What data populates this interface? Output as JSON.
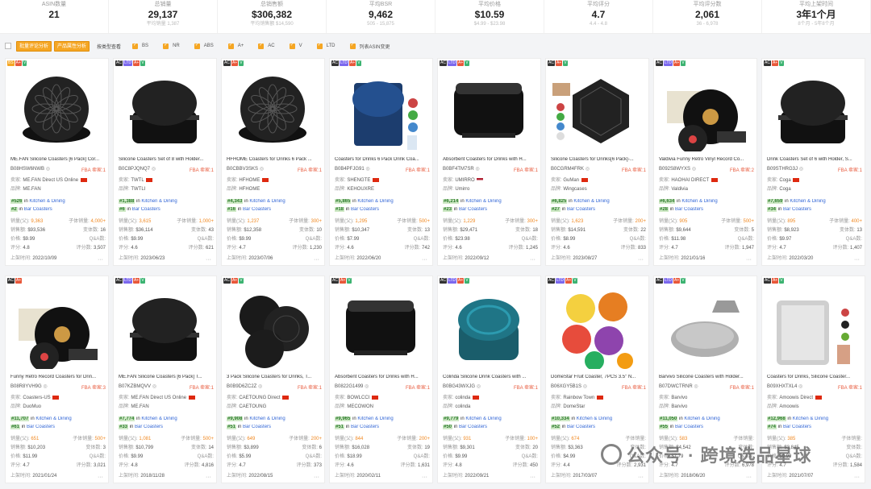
{
  "stats": [
    {
      "label": "ASIN数量",
      "value": "21",
      "sub": ""
    },
    {
      "label": "总销量",
      "value": "29,137",
      "sub": "平均销量 1,387"
    },
    {
      "label": "总销售额",
      "value": "$306,382",
      "sub": "平均销售额 $14,590"
    },
    {
      "label": "平均BSR",
      "value": "9,462",
      "sub": "505 - 15,875"
    },
    {
      "label": "平均价格",
      "value": "$10.59",
      "sub": "$4.99 - $23.98"
    },
    {
      "label": "平均评分",
      "value": "4.7",
      "sub": "4.4 - 4.8"
    },
    {
      "label": "平均评分数",
      "value": "2,061",
      "sub": "36 - 6,978"
    },
    {
      "label": "平均上架时间",
      "value": "3年1个月",
      "sub": "8个月 - 5年8个月"
    }
  ],
  "toolbar": {
    "btn1": "批量评论分析",
    "btn2": "产品属性分析",
    "label": "按类型查看",
    "checks": [
      "BS",
      "NR",
      "ABS",
      "A+",
      "AC",
      "V",
      "LTD",
      "列表ASIN变更"
    ]
  },
  "labels": {
    "seller": "卖家:",
    "brand": "品牌:",
    "in": "in",
    "sales": "销量(父):",
    "child_sales": "子体销量:",
    "revenue": "销售额:",
    "variants": "变体数:",
    "price": "价格:",
    "qa": "Q&A数:",
    "rating": "评分:",
    "reviews": "评分数:",
    "listed": "上架时间:",
    "fba": "FBA",
    "sellers_n": "卖家:",
    "more": "···"
  },
  "products": [
    {
      "tags": [
        "best",
        "aplus",
        "v"
      ],
      "title": "ME.FAN Silicone Coasters [6 Pack] Cor...",
      "asin": "B08HSW6NWB",
      "sellers": "1",
      "seller": "ME.FAN Direct US Online",
      "brand": "ME.FAN",
      "r1": "#526",
      "c1": "Kitchen & Dining",
      "r2": "#2",
      "c2": "Bar Coasters",
      "sales": "9,363",
      "child": "4,000+",
      "revenue": "$93,536",
      "variants": "16",
      "price": "$9.99",
      "qa": "",
      "rating": "4.8",
      "reviews": "3,507",
      "date": "2022/10/09",
      "flag": "cn",
      "shape": "flower"
    },
    {
      "tags": [
        "ac",
        "ltd",
        "aplus",
        "v"
      ],
      "title": "Silicone Coasters Set of 8 with Holder...",
      "asin": "B0C8PJQNQ7",
      "sellers": "1",
      "seller": "TWTL",
      "brand": "TWTLI",
      "r1": "#1,388",
      "c1": "Kitchen & Dining",
      "r2": "#6",
      "c2": "Bar Coasters",
      "sales": "3,615",
      "child": "1,000+",
      "revenue": "$36,114",
      "variants": "43",
      "price": "$9.99",
      "qa": "",
      "rating": "4.6",
      "reviews": "621",
      "date": "2023/06/23",
      "flag": "cn",
      "shape": "stack"
    },
    {
      "tags": [
        "ac",
        "aplus",
        "v"
      ],
      "title": "HFHOME Coasters for Drinks 6 Pack ...",
      "asin": "B0CBBV3SKS",
      "sellers": "1",
      "seller": "HFHOME",
      "brand": "HFHOME",
      "r1": "#4,343",
      "c1": "Kitchen & Dining",
      "r2": "#16",
      "c2": "Bar Coasters",
      "sales": "1,237",
      "child": "300+",
      "revenue": "$12,358",
      "variants": "10",
      "price": "$9.99",
      "qa": "",
      "rating": "4.7",
      "reviews": "1,230",
      "date": "2023/07/06",
      "flag": "cn",
      "shape": "flower"
    },
    {
      "tags": [
        "ac",
        "ltd",
        "aplus",
        "v"
      ],
      "title": "Coasters for Drinks 6 Pack Drink Coa...",
      "asin": "B0B4PFJG91",
      "sellers": "1",
      "seller": "SHENGTE",
      "brand": "KEHOUXRE",
      "r1": "#5,865",
      "c1": "Kitchen & Dining",
      "r2": "#18",
      "c2": "Bar Coasters",
      "sales": "1,295",
      "child": "500+",
      "revenue": "$10,347",
      "variants": "13",
      "price": "$7.99",
      "qa": "",
      "rating": "4.6",
      "reviews": "742",
      "date": "2022/06/20",
      "flag": "cn",
      "shape": "blue"
    },
    {
      "tags": [
        "ac",
        "ltd",
        "aplus",
        "v"
      ],
      "title": "Absorbent Coasters for Drinks with H...",
      "asin": "B0BF4TM7SR",
      "sellers": "1",
      "seller": "UMIRRO",
      "brand": "Umirro",
      "r1": "#6,214",
      "c1": "Kitchen & Dining",
      "r2": "#23",
      "c2": "Bar Coasters",
      "sales": "1,229",
      "child": "300+",
      "revenue": "$29,471",
      "variants": "18",
      "price": "$23.98",
      "qa": "",
      "rating": "4.6",
      "reviews": "1,245",
      "date": "2022/09/12",
      "flag": "us",
      "shape": "square"
    },
    {
      "tags": [
        "ac",
        "aplus",
        "v"
      ],
      "title": "Silicone Coasters for Drinks[6 Pack]-...",
      "asin": "B0CGRM4FRK",
      "sellers": "1",
      "seller": "GuMan",
      "brand": "Wingcases",
      "r1": "#6,825",
      "c1": "Kitchen & Dining",
      "r2": "#27",
      "c2": "Bar Coasters",
      "sales": "1,623",
      "child": "200+",
      "revenue": "$14,591",
      "variants": "22",
      "price": "$8.99",
      "qa": "",
      "rating": "4.6",
      "reviews": "833",
      "date": "2023/08/27",
      "flag": "cn",
      "shape": "hex"
    },
    {
      "tags": [
        "ac",
        "ltd",
        "aplus",
        "v"
      ],
      "title": "Valdivia Funny Retro Vinyl Record Co...",
      "asin": "B092S8WYXS",
      "sellers": "2",
      "seller": "HAOHAI DIRECT",
      "brand": "Valdivia",
      "r1": "#6,634",
      "c1": "Kitchen & Dining",
      "r2": "#28",
      "c2": "Bar Coasters",
      "sales": "905",
      "child": "500+",
      "revenue": "$9,644",
      "variants": "5",
      "price": "$11.98",
      "qa": "",
      "rating": "4.7",
      "reviews": "1,947",
      "date": "2021/01/16",
      "flag": "cn",
      "shape": "vinyl"
    },
    {
      "tags": [
        "ac",
        "aplus",
        "v"
      ],
      "title": "Drink Coasters Set of 6 with Holder, S...",
      "asin": "B09STHRG3J",
      "sellers": "1",
      "seller": "Coga",
      "brand": "Coga",
      "r1": "#7,659",
      "c1": "Kitchen & Dining",
      "r2": "#34",
      "c2": "Bar Coasters",
      "sales": "895",
      "child": "400+",
      "revenue": "$8,923",
      "variants": "13",
      "price": "$9.97",
      "qa": "",
      "rating": "4.7",
      "reviews": "1,407",
      "date": "2022/03/20",
      "flag": "cn",
      "shape": "stack"
    },
    {
      "tags": [
        "ac",
        "aplus"
      ],
      "title": "Funny Retro Record Coasters for Drin...",
      "asin": "B08R8YVH9G",
      "sellers": "3",
      "seller": "Coasters-US",
      "brand": "DuoMuo",
      "r1": "#11,707",
      "c1": "Kitchen & Dining",
      "r2": "#61",
      "c2": "Bar Coasters",
      "sales": "651",
      "child": "500+",
      "revenue": "$10,203",
      "variants": "3",
      "price": "$11.99",
      "qa": "",
      "rating": "4.7",
      "reviews": "3,021",
      "date": "2021/01/24",
      "flag": "cn",
      "shape": "vinyl"
    },
    {
      "tags": [
        "ac",
        "ltd",
        "aplus",
        "v"
      ],
      "title": "ME.FAN Silicone Coasters [6 Pack] T...",
      "asin": "B07KZBMQVV",
      "sellers": "1",
      "seller": "ME.FAN Direct US Online",
      "brand": "ME.FAN",
      "r1": "#7,774",
      "c1": "Kitchen & Dining",
      "r2": "#33",
      "c2": "Bar Coasters",
      "sales": "1,081",
      "child": "500+",
      "revenue": "$10,799",
      "variants": "14",
      "price": "$9.99",
      "qa": "",
      "rating": "4.8",
      "reviews": "4,816",
      "date": "2018/11/28",
      "flag": "cn",
      "shape": "stack"
    },
    {
      "tags": [
        "ac",
        "aplus",
        "v"
      ],
      "title": "3 Pack Silicone Coasters for Drinks, T...",
      "asin": "B0B9D6ZC2Z",
      "sellers": "1",
      "seller": "CAETOUNG Direct",
      "brand": "CAETOUNG",
      "r1": "#9,908",
      "c1": "Kitchen & Dining",
      "r2": "#51",
      "c2": "Bar Coasters",
      "sales": "649",
      "child": "200+",
      "revenue": "$3,899",
      "variants": "6",
      "price": "$5.99",
      "qa": "",
      "rating": "4.7",
      "reviews": "373",
      "date": "2022/08/15",
      "flag": "cn",
      "shape": "three"
    },
    {
      "tags": [
        "ac",
        "aplus",
        "v"
      ],
      "title": "Absorbent Coasters for Drinks with H...",
      "asin": "B0822G1499",
      "sellers": "1",
      "seller": "BOWLCCI",
      "brand": "MECOWON",
      "r1": "#9,965",
      "c1": "Kitchen & Dining",
      "r2": "#51",
      "c2": "Bar Coasters",
      "sales": "844",
      "child": "200+",
      "revenue": "$16,028",
      "variants": "19",
      "price": "$18.99",
      "qa": "",
      "rating": "4.6",
      "reviews": "1,631",
      "date": "2020/02/11",
      "flag": "cn",
      "shape": "square"
    },
    {
      "tags": [
        "ac",
        "ltd",
        "aplus",
        "v"
      ],
      "title": "Colinda Silicone Drink Coasters with ...",
      "asin": "B0BG43WXJG",
      "sellers": "1",
      "seller": "colinda",
      "brand": "colinda",
      "r1": "#9,779",
      "c1": "Kitchen & Dining",
      "r2": "#50",
      "c2": "Bar Coasters",
      "sales": "931",
      "child": "100+",
      "revenue": "$9,301",
      "variants": "20",
      "price": "$9.99",
      "qa": "",
      "rating": "4.8",
      "reviews": "450",
      "date": "2022/09/21",
      "flag": "cn",
      "shape": "teal"
    },
    {
      "tags": [
        "ac",
        "ltd",
        "aplus",
        "v"
      ],
      "title": "DomeStar Fruit Coaster, 7PCS 3.5\" N...",
      "asin": "B06XGY5B1S",
      "sellers": "1",
      "seller": "Rainbow Town",
      "brand": "DomeStar",
      "r1": "#10,334",
      "c1": "Kitchen & Dining",
      "r2": "#52",
      "c2": "Bar Coasters",
      "sales": "674",
      "child": "",
      "revenue": "$3,363",
      "variants": "",
      "price": "$4.99",
      "qa": "",
      "rating": "4.4",
      "reviews": "2,931",
      "date": "2017/03/07",
      "flag": "cn",
      "shape": "fruit"
    },
    {
      "tags": [
        "ac",
        "ltd",
        "aplus",
        "v"
      ],
      "title": "Barvivo Silicone Coasters with Holder...",
      "asin": "B07DWCTRNR",
      "sellers": "1",
      "seller": "Barvivo",
      "brand": "Barvivo",
      "r1": "#11,050",
      "c1": "Kitchen & Dining",
      "r2": "#55",
      "c2": "Bar Coasters",
      "sales": "583",
      "child": "",
      "revenue": "$4,542",
      "variants": "",
      "price": "$7.79",
      "qa": "",
      "rating": "4.7",
      "reviews": "6,978",
      "date": "2018/06/20",
      "flag": "",
      "shape": "grey"
    },
    {
      "tags": [
        "ac",
        "aplus",
        "v"
      ],
      "title": "Coasters for Drinks, Silicone Coaster...",
      "asin": "B09XHXTXL4",
      "sellers": "1",
      "seller": "Amoowis Direct",
      "brand": "Amoowis",
      "r1": "#12,968",
      "c1": "Kitchen & Dining",
      "r2": "#74",
      "c2": "Bar Coasters",
      "sales": "385",
      "child": "",
      "revenue": "$3,845",
      "variants": "",
      "price": "$9.99",
      "qa": "",
      "rating": "4.7",
      "reviews": "1,584",
      "date": "2021/07/07",
      "flag": "cn",
      "shape": "silver"
    }
  ],
  "watermark": "公众号 · 跨境选品星球"
}
